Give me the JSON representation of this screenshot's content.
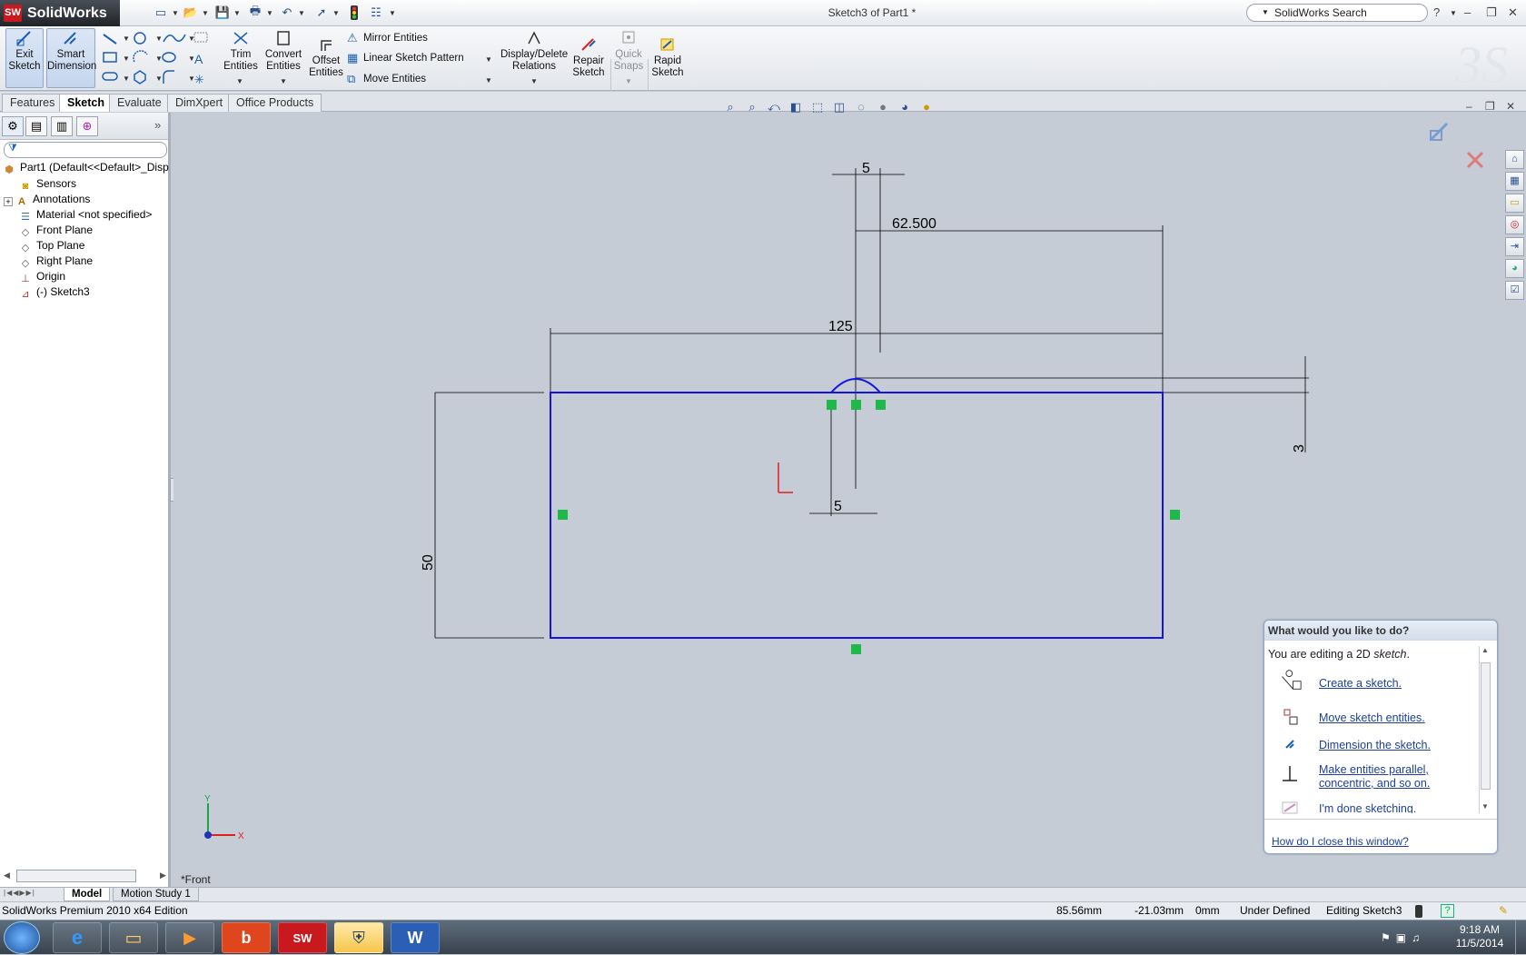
{
  "app": {
    "name": "SolidWorks",
    "logo_abbr": "SW",
    "doc_title": "Sketch3 of Part1 *",
    "search_placeholder": "SolidWorks Search"
  },
  "quick_access_icons": [
    "new-document-icon",
    "open-folder-icon",
    "save-icon",
    "print-icon",
    "undo-icon",
    "select-arrow-icon",
    "rebuild-traffic-light-icon",
    "options-icon"
  ],
  "ribbon": {
    "exit_sketch": "Exit\nSketch",
    "smart_dimension": "Smart\nDimension",
    "trim": "Trim\nEntities",
    "convert": "Convert\nEntities",
    "offset": "Offset\nEntities",
    "mirror": "Mirror Entities",
    "linear_pattern": "Linear Sketch Pattern",
    "move": "Move Entities",
    "display_delete": "Display/Delete\nRelations",
    "repair": "Repair\nSketch",
    "quick_snaps": "Quick\nSnaps",
    "rapid_sketch": "Rapid\nSketch"
  },
  "tabs": [
    "Features",
    "Sketch",
    "Evaluate",
    "DimXpert",
    "Office Products"
  ],
  "active_tab": "Sketch",
  "tree": {
    "root": "Part1  (Default<<Default>_Disp",
    "items": [
      "Sensors",
      "Annotations",
      "Material <not specified>",
      "Front Plane",
      "Top Plane",
      "Right Plane",
      "Origin",
      "(-) Sketch3"
    ]
  },
  "sketch": {
    "dims": {
      "top_width": "5",
      "half_width": "62.500",
      "total_width": "125",
      "height": "50",
      "arc_offset": "3",
      "slot_width": "5"
    },
    "view_label": "*Front",
    "axes": {
      "x": "X",
      "y": "Y"
    }
  },
  "help_panel": {
    "title": "What would you like to do?",
    "intro_prefix": "You are editing a 2D ",
    "intro_emph": "sketch",
    "intro_suffix": ".",
    "links": [
      "Create a sketch.",
      "Move sketch entities.",
      "Dimension the sketch.",
      "Make entities parallel, concentric, and so on.",
      "I'm done sketching."
    ],
    "close_link": "How do I close this window?"
  },
  "bottom_tabs": [
    "Model",
    "Motion Study 1"
  ],
  "status": {
    "edition": "SolidWorks Premium 2010 x64 Edition",
    "x": "85.56mm",
    "y": "-21.03mm",
    "z": "0mm",
    "state": "Under Defined",
    "editing": "Editing Sketch3"
  },
  "taskbar": {
    "time": "9:18 AM",
    "date": "11/5/2014"
  },
  "colors": {
    "sketch_line": "#1414e6",
    "relation_green": "#1fb84a",
    "dim_line": "#000000",
    "canvas": "#c5ccd6"
  }
}
